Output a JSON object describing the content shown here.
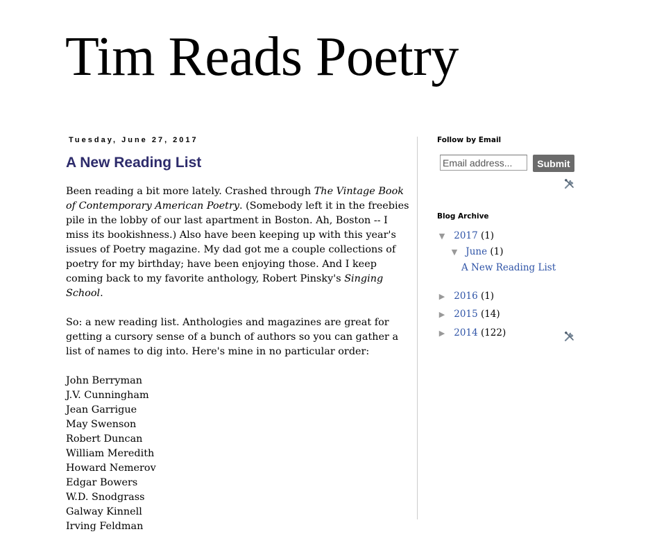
{
  "blog": {
    "title": "Tim Reads Poetry"
  },
  "post": {
    "date": "Tuesday, June 27, 2017",
    "title": "A New Reading List",
    "para1": {
      "t1": "Been reading a bit more lately. Crashed through ",
      "em1": "The Vintage Book of Contemporary American Poetry",
      "t2": ". (Somebody left it in the freebies pile in the lobby of our last apartment in Boston. Ah, Boston -- I miss its bookishness.) Also have been keeping up with this year's issues of Poetry magazine. My dad got me a couple collections of poetry for my birthday; have been enjoying those. And I keep coming back to my favorite anthology, Robert Pinsky's ",
      "em2": "Singing School",
      "t3": "."
    },
    "para2": "So: a new reading list. Anthologies and magazines are great for getting a cursory sense of a bunch of authors so you can gather a list of names to dig into. Here's mine in no particular order:",
    "authors": [
      "John Berryman",
      "J.V. Cunningham",
      "Jean Garrigue",
      "May Swenson",
      "Robert Duncan",
      "William Meredith",
      "Howard Nemerov",
      "Edgar Bowers",
      "W.D. Snodgrass",
      "Galway Kinnell",
      "Irving Feldman"
    ]
  },
  "sidebar": {
    "follow": {
      "title": "Follow by Email",
      "placeholder": "Email address...",
      "submit_label": "Submit"
    },
    "archive": {
      "title": "Blog Archive",
      "years": [
        {
          "year": "2017",
          "count": "(1)",
          "expanded": true
        },
        {
          "year": "2016",
          "count": "(1)",
          "expanded": false
        },
        {
          "year": "2015",
          "count": "(14)",
          "expanded": false
        },
        {
          "year": "2014",
          "count": "(122)",
          "expanded": false
        }
      ],
      "months": [
        {
          "month": "June",
          "count": "(1)"
        }
      ],
      "posts": [
        {
          "title": "A New Reading List"
        }
      ]
    }
  },
  "icons": {
    "expanded_toggle": "triangle-down",
    "collapsed_toggle": "triangle-right",
    "edit": "screwdriver-wrench-icon"
  },
  "colors": {
    "post_title": "#2d2b6b",
    "link": "#2f54a7",
    "submit_bg": "#6b6b6b"
  }
}
